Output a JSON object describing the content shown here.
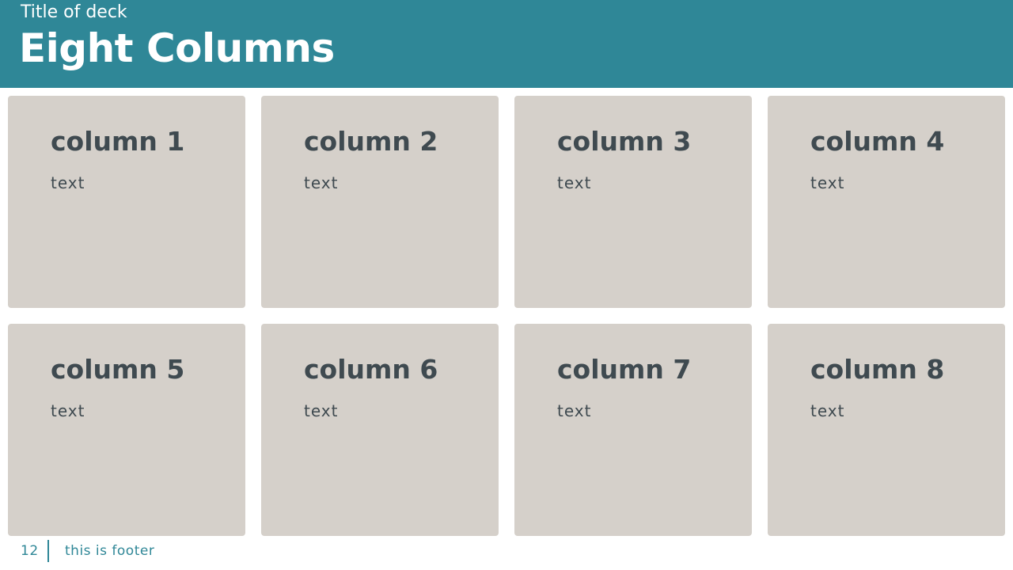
{
  "header": {
    "deck_title": "Title of deck",
    "slide_title": "Eight Columns"
  },
  "columns": [
    {
      "title": "column 1",
      "text": "text"
    },
    {
      "title": "column 2",
      "text": "text"
    },
    {
      "title": "column 3",
      "text": "text"
    },
    {
      "title": "column 4",
      "text": "text"
    },
    {
      "title": "column 5",
      "text": "text"
    },
    {
      "title": "column 6",
      "text": "text"
    },
    {
      "title": "column 7",
      "text": "text"
    },
    {
      "title": "column 8",
      "text": "text"
    }
  ],
  "footer": {
    "page_number": "12",
    "text": "this is footer"
  },
  "colors": {
    "header_background": "#2f8797",
    "card_background": "#d5d0ca",
    "card_text": "#3f4a50",
    "footer_text": "#2f8797"
  }
}
